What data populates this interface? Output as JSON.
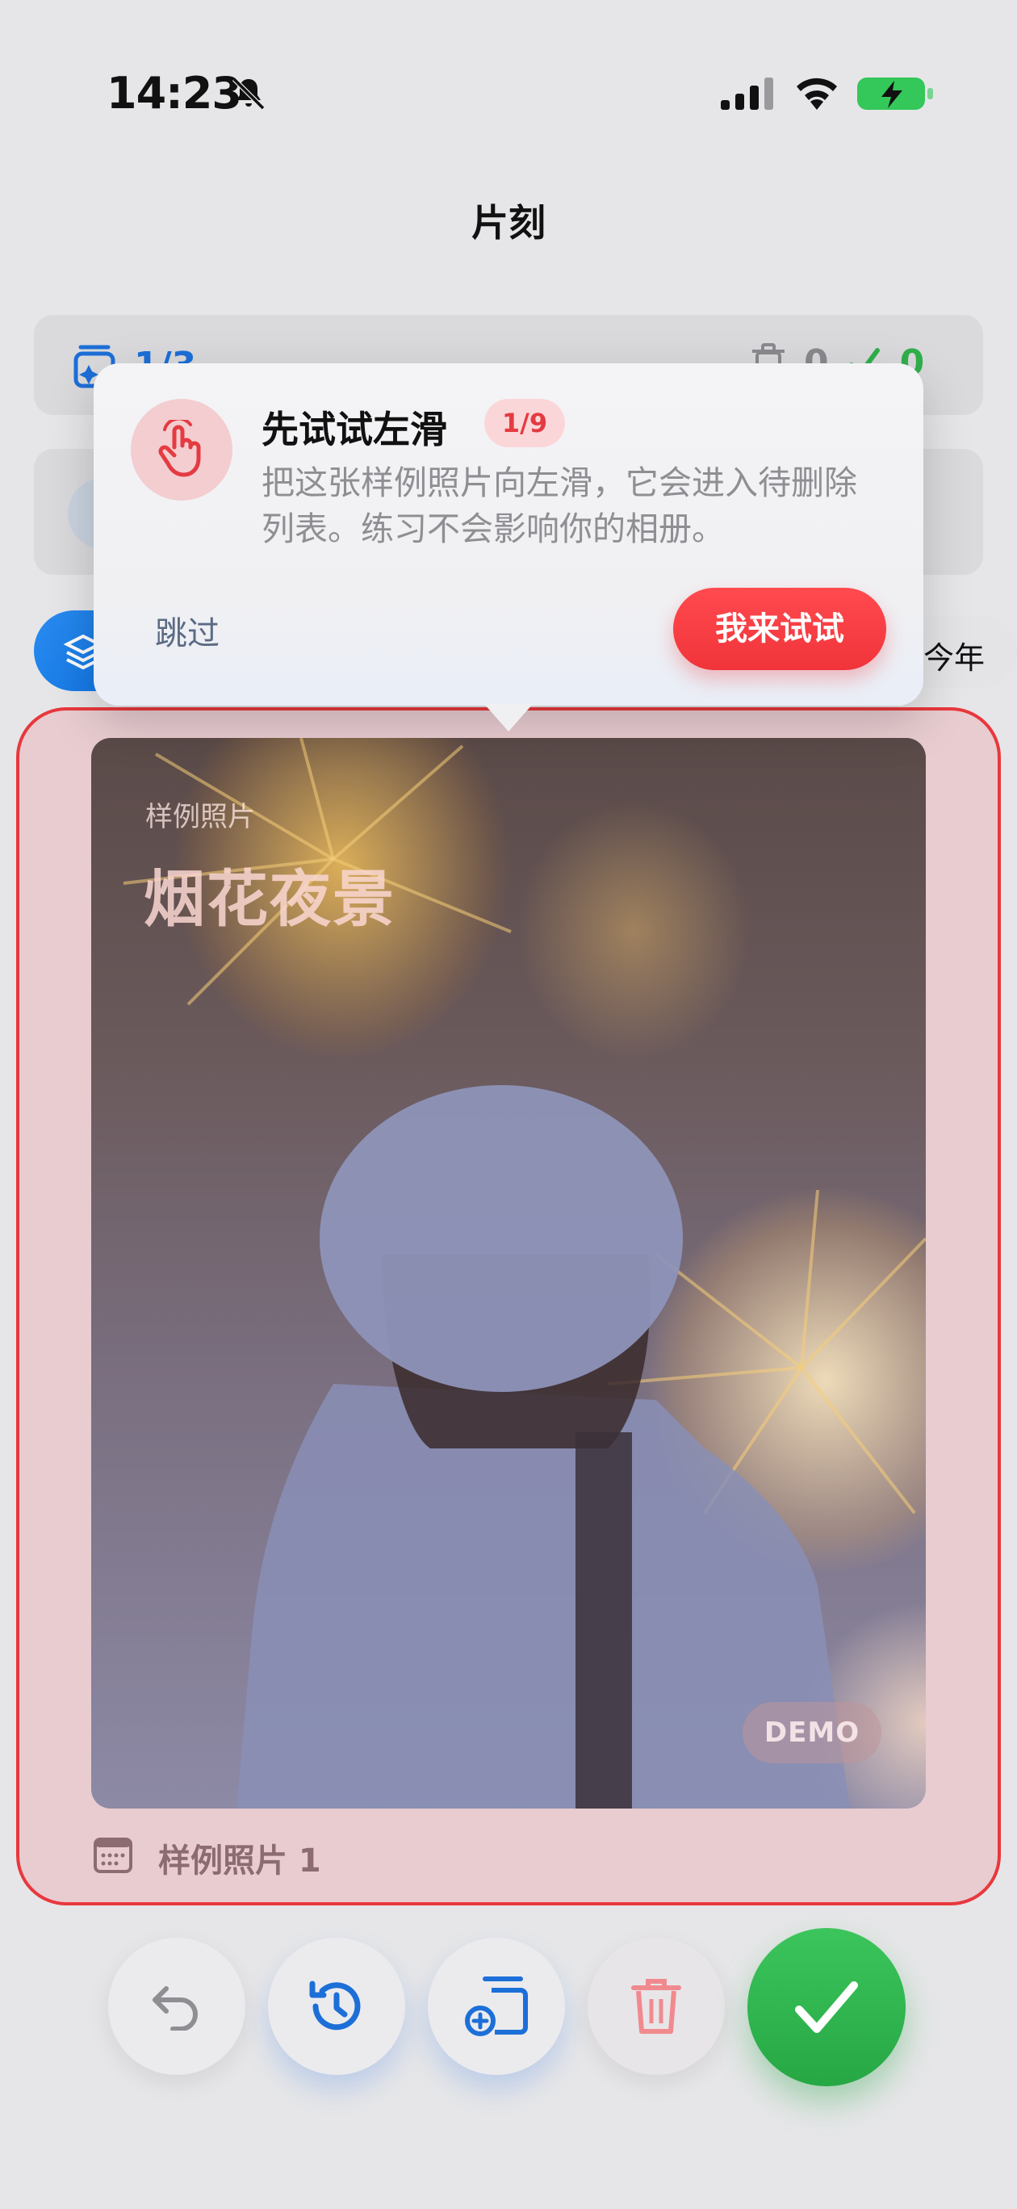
{
  "status_bar": {
    "time": "14:23",
    "icons": [
      "bell-slash-icon",
      "signal-icon",
      "wifi-icon",
      "battery-charging-icon"
    ]
  },
  "nav": {
    "title": "片刻"
  },
  "stats": {
    "progress": "1/3",
    "deleted_count": "0",
    "kept_count": "0"
  },
  "filter": {
    "year_label": "今年"
  },
  "photo": {
    "subtitle": "样例照片",
    "title": "烟花夜景",
    "badge": "DEMO",
    "caption": "样例照片 1"
  },
  "popover": {
    "title": "先试试左滑",
    "step": "1/9",
    "body": "把这张样例照片向左滑，它会进入待删除列表。练习不会影响你的相册。",
    "skip_label": "跳过",
    "try_label": "我来试试"
  },
  "colors": {
    "accent_red": "#f0343a",
    "accent_blue": "#1d6fd8",
    "accent_green": "#30b04b"
  }
}
